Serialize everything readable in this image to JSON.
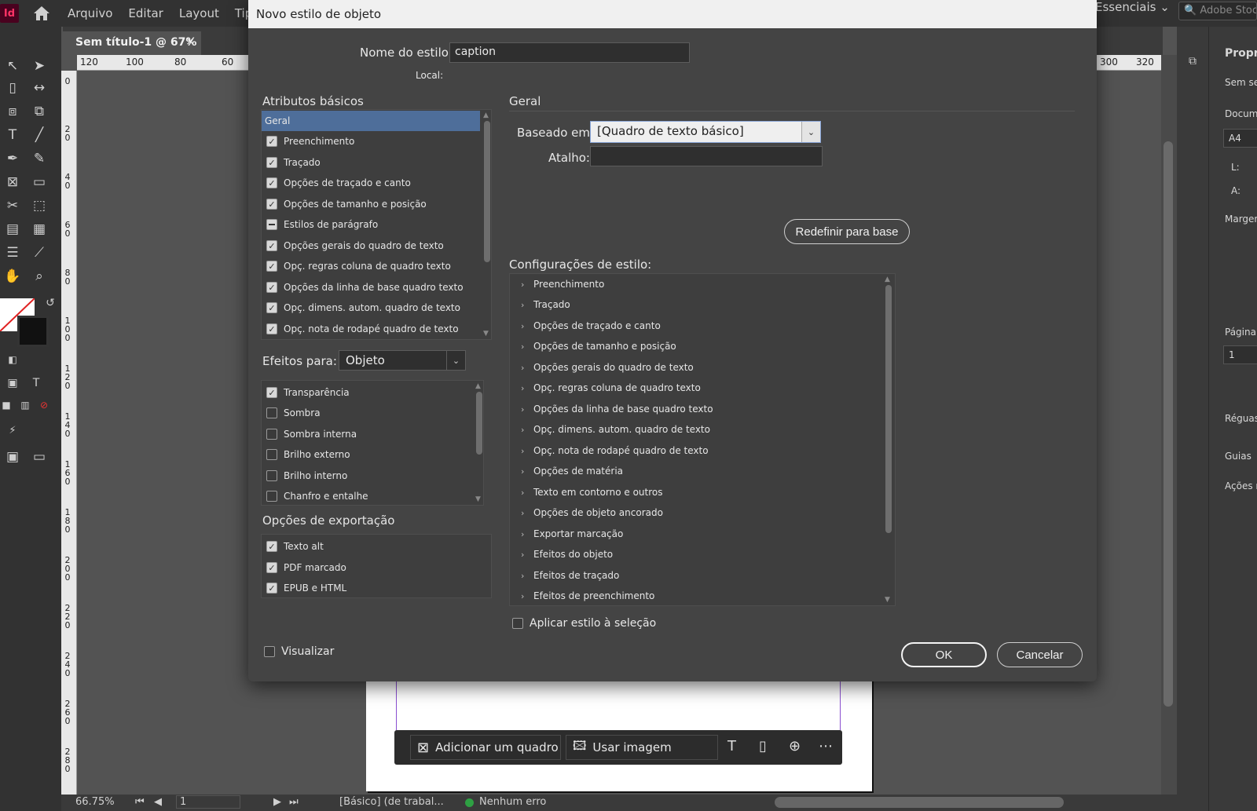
{
  "app": {
    "logo": "Id",
    "menus": [
      "Arquivo",
      "Editar",
      "Layout",
      "Tipo"
    ],
    "workspace": "Essenciais",
    "stock_search": "Adobe Stock"
  },
  "document": {
    "tab_title": "Sem título-1 @ 67%",
    "tab_close": "×",
    "ruler_top_labels_left": [
      "120",
      "100",
      "80",
      "60"
    ],
    "ruler_top_labels_right": [
      "300",
      "320"
    ],
    "ruler_left_labels": [
      "0",
      "20",
      "40",
      "60",
      "80",
      "100",
      "120",
      "140",
      "160",
      "180",
      "200",
      "220",
      "240",
      "260",
      "280"
    ]
  },
  "context_bar": {
    "add_frame": "Adicionar um quadro",
    "use_image": "Usar imagem"
  },
  "status": {
    "zoom": "66.75%",
    "page": "1",
    "style": "[Básico] (de trabal...",
    "errors": "Nenhum erro",
    "error_color": "#2ea043"
  },
  "properties_panel": {
    "title": "Propriedades",
    "no_selection": "Sem seleção",
    "document": "Documento",
    "preset": "A4",
    "width_label": "L:",
    "height_label": "A:",
    "margins": "Margens",
    "page": "Página",
    "page_value": "1",
    "rulers": "Réguas",
    "guides": "Guias",
    "quick_actions": "Ações rápidas"
  },
  "dialog": {
    "title": "Novo estilo de objeto",
    "style_name_label": "Nome do estilo:",
    "style_name_value": "caption",
    "location_label": "Local:",
    "basic_attributes_title": "Atributos básicos",
    "basic_attributes": [
      {
        "label": "Geral",
        "state": "none",
        "selected": true
      },
      {
        "label": "Preenchimento",
        "state": "checked"
      },
      {
        "label": "Traçado",
        "state": "checked"
      },
      {
        "label": "Opções de traçado e canto",
        "state": "checked"
      },
      {
        "label": "Opções de tamanho e posição",
        "state": "checked"
      },
      {
        "label": "Estilos de parágrafo",
        "state": "mixed"
      },
      {
        "label": "Opções gerais do quadro de texto",
        "state": "checked"
      },
      {
        "label": "Opç. regras coluna de quadro texto",
        "state": "checked"
      },
      {
        "label": "Opções da linha de base quadro texto",
        "state": "checked"
      },
      {
        "label": "Opç. dimens. autom. quadro de texto",
        "state": "checked"
      },
      {
        "label": "Opç. nota de rodapé quadro de texto",
        "state": "checked"
      }
    ],
    "effects_for_label": "Efeitos para:",
    "effects_for_value": "Objeto",
    "effects": [
      {
        "label": "Transparência",
        "state": "checked"
      },
      {
        "label": "Sombra",
        "state": "unchecked"
      },
      {
        "label": "Sombra interna",
        "state": "unchecked"
      },
      {
        "label": "Brilho externo",
        "state": "unchecked"
      },
      {
        "label": "Brilho interno",
        "state": "unchecked"
      },
      {
        "label": "Chanfro e entalhe",
        "state": "unchecked"
      }
    ],
    "export_options_title": "Opções de exportação",
    "export_options": [
      {
        "label": "Texto alt",
        "state": "checked"
      },
      {
        "label": "PDF marcado",
        "state": "checked"
      },
      {
        "label": "EPUB e HTML",
        "state": "checked"
      }
    ],
    "general_title": "Geral",
    "based_on_label": "Baseado em:",
    "based_on_value": "[Quadro de texto básico]",
    "shortcut_label": "Atalho:",
    "shortcut_value": "",
    "reset_button": "Redefinir para base",
    "style_settings_title": "Configurações de estilo:",
    "style_settings": [
      "Preenchimento",
      "Traçado",
      "Opções de traçado e canto",
      "Opções de tamanho e posição",
      "Opções gerais do quadro de texto",
      "Opç. regras coluna de quadro texto",
      "Opções da linha de base quadro texto",
      "Opç. dimens. autom. quadro de texto",
      "Opç. nota de rodapé quadro de texto",
      "Opções de matéria",
      "Texto em contorno e outros",
      "Opções de objeto ancorado",
      "Exportar marcação",
      "Efeitos do objeto",
      "Efeitos de traçado",
      "Efeitos de preenchimento"
    ],
    "apply_to_selection_label": "Aplicar estilo à seleção",
    "preview_label": "Visualizar",
    "ok_button": "OK",
    "cancel_button": "Cancelar"
  }
}
